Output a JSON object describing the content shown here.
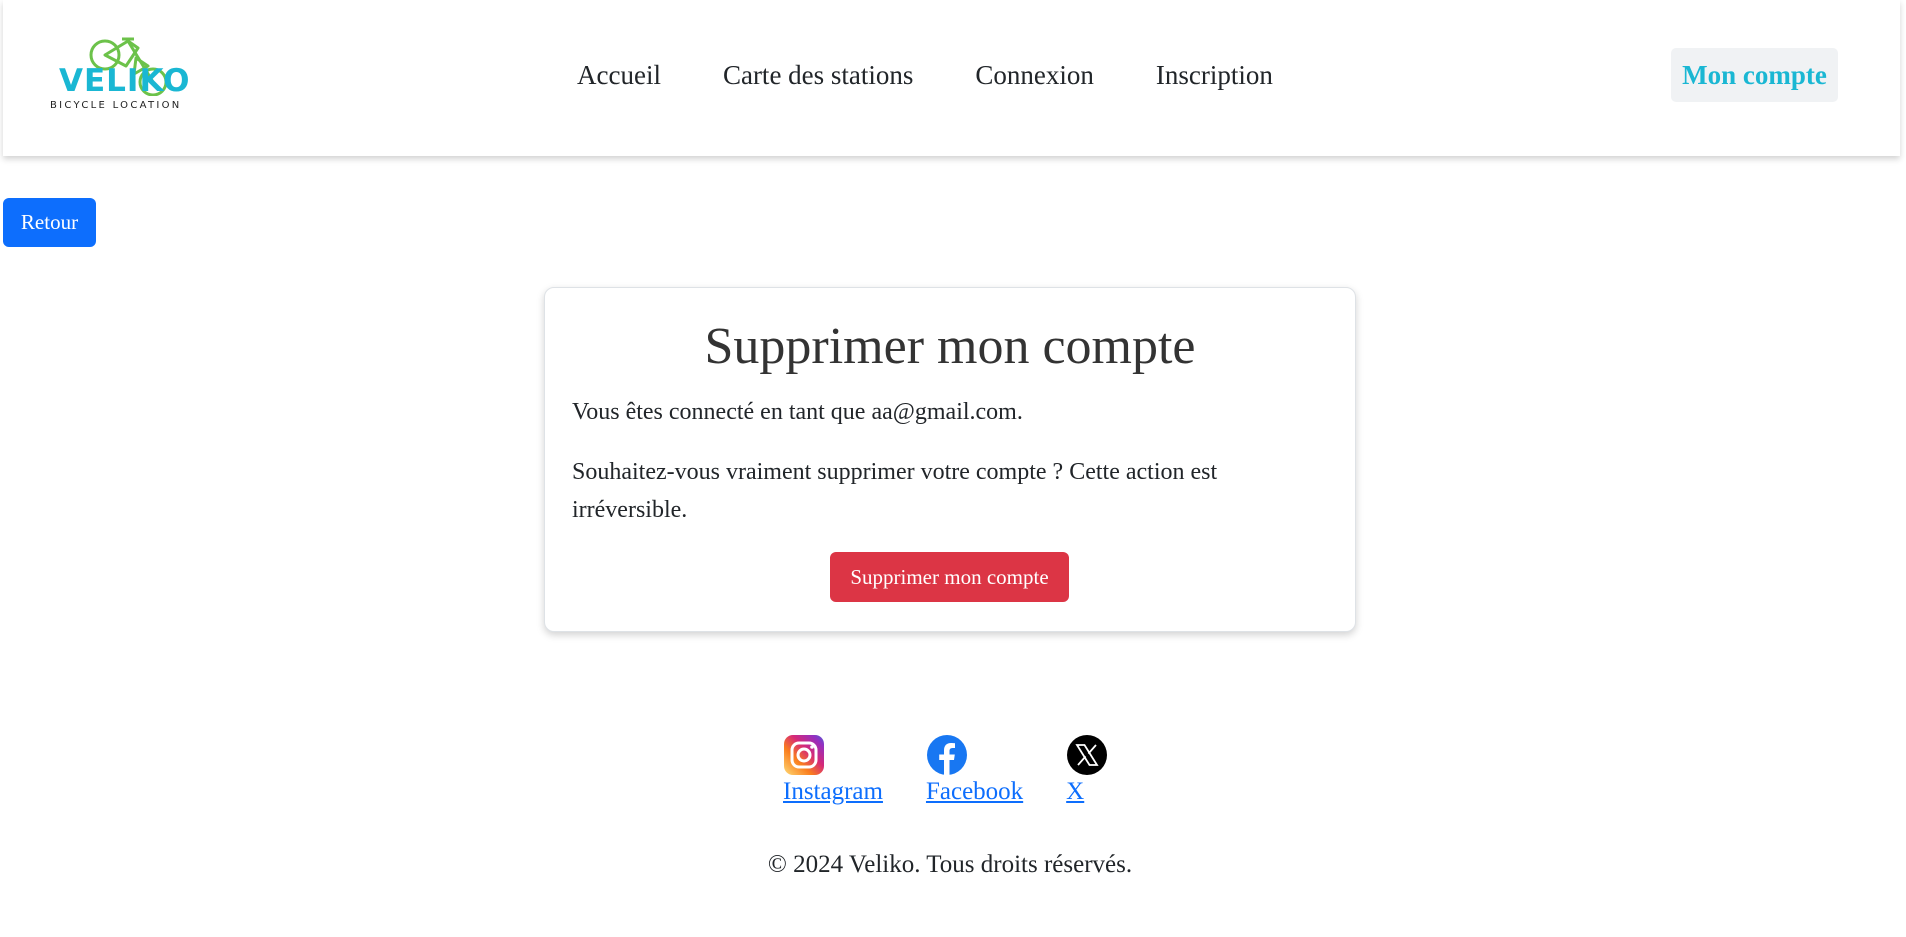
{
  "brand": {
    "name": "VELIKO",
    "tagline": "BICYCLE LOCATION",
    "primary_color": "#1ab7d3",
    "accent_color": "#6cc24a"
  },
  "nav": {
    "items": [
      {
        "label": "Accueil"
      },
      {
        "label": "Carte des stations"
      },
      {
        "label": "Connexion"
      },
      {
        "label": "Inscription"
      }
    ],
    "account_label": "Mon compte"
  },
  "back_label": "Retour",
  "card": {
    "title": "Supprimer mon compte",
    "logged_in_text": "Vous êtes connecté en tant que aa@gmail.com.",
    "confirm_text": "Souhaitez-vous vraiment supprimer votre compte ? Cette action est irréversible.",
    "delete_label": "Supprimer mon compte"
  },
  "footer": {
    "socials": [
      {
        "label": "Instagram",
        "icon": "instagram-icon"
      },
      {
        "label": "Facebook",
        "icon": "facebook-icon"
      },
      {
        "label": "X",
        "icon": "x-icon"
      }
    ],
    "copyright": "© 2024 Veliko. Tous droits réservés."
  },
  "colors": {
    "primary_button": "#0d6efd",
    "danger_button": "#dc3545",
    "link": "#0d6efd"
  }
}
